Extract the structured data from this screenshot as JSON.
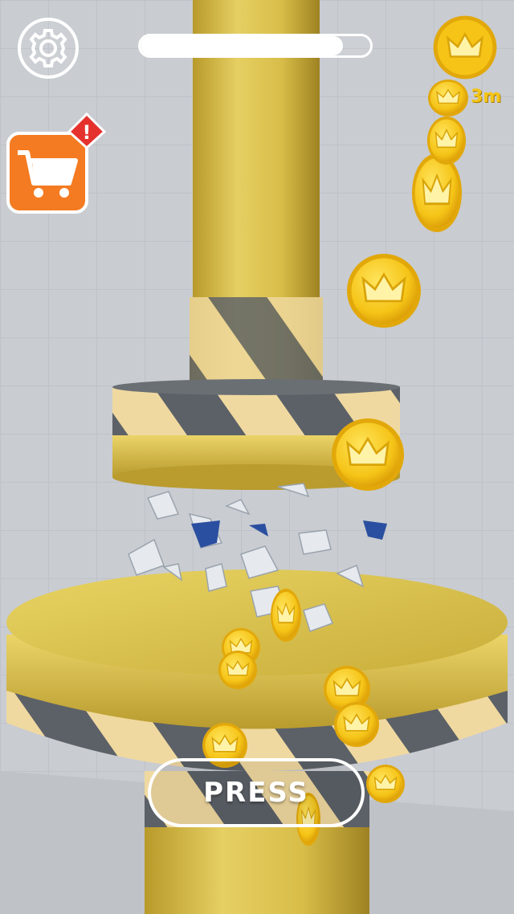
{
  "hud": {
    "settings_icon": "gear-icon",
    "shop_icon": "shopping-cart-icon",
    "shop_alert_icon": "exclamation-alert-icon",
    "shop_alert_symbol": "!",
    "coin_icon": "crown-coin-icon",
    "coin_count": "3m",
    "level_progress": 0.88
  },
  "press_button": {
    "label": "PRESS"
  },
  "colors": {
    "background": "#c9ccd1",
    "cylinder_gold": "#d9bf4a",
    "stripe_dark": "#5c6168",
    "stripe_light": "#f0d9a0",
    "coin": "#f5c417",
    "shop_orange": "#f47b21",
    "alert_red": "#e5322d"
  }
}
